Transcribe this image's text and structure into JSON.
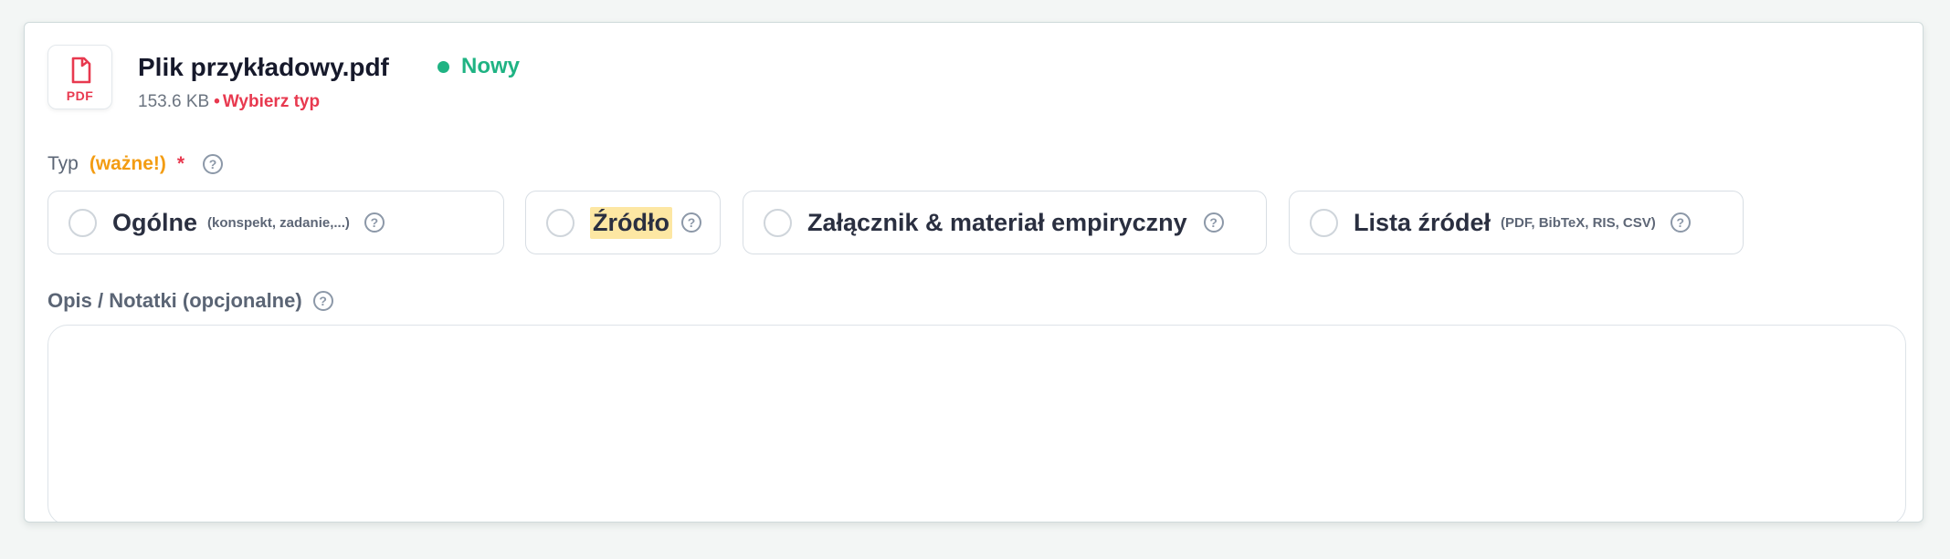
{
  "file": {
    "icon": "pdf-file-icon",
    "icon_label": "PDF",
    "name": "Plik przykładowy.pdf",
    "status": "Nowy",
    "size": "153.6 KB",
    "separator": "•",
    "type_prompt": "Wybierz typ"
  },
  "type_field": {
    "label": "Typ",
    "important": "(ważne!)",
    "required_mark": "*",
    "help": "?",
    "options": [
      {
        "label": "Ogólne",
        "hint": "(konspekt, zadanie,...)",
        "help": "?"
      },
      {
        "label": "Źródło",
        "hint": "",
        "help": "?",
        "highlighted": true
      },
      {
        "label": "Załącznik & materiał empiryczny",
        "hint": "",
        "help": "?"
      },
      {
        "label": "Lista źródeł",
        "hint": "(PDF, BibTeX, RIS, CSV)",
        "help": "?"
      }
    ]
  },
  "notes_field": {
    "label": "Opis / Notatki (opcjonalne)",
    "help": "?",
    "value": ""
  },
  "colors": {
    "status_green": "#1fb383",
    "error_red": "#e8394f",
    "important_orange": "#f39c12",
    "highlight_yellow": "#fde7a3"
  }
}
